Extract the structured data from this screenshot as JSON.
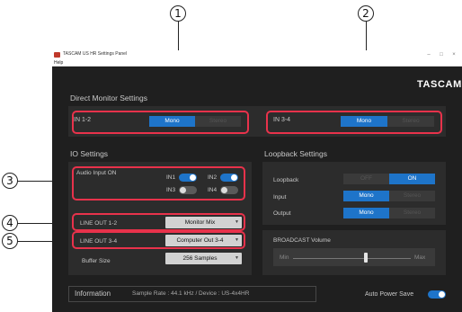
{
  "callouts": {
    "c1": "1",
    "c2": "2",
    "c3": "3",
    "c4": "4",
    "c5": "5"
  },
  "window": {
    "title": "TASCAM US HR Settings Panel",
    "menu": "Help",
    "controls": {
      "minimize": "–",
      "maximize": "□",
      "close": "×"
    },
    "logo": "TASCAM"
  },
  "direct_monitor": {
    "heading": "Direct Monitor Settings",
    "ch12": {
      "label": "IN 1-2",
      "opt_mono": "Mono",
      "opt_stereo": "Stereo",
      "selected": "Mono"
    },
    "ch34": {
      "label": "IN 3-4",
      "opt_mono": "Mono",
      "opt_stereo": "Stereo",
      "selected": "Mono"
    }
  },
  "io": {
    "heading": "IO Settings",
    "audio_input_on": {
      "label": "Audio Input ON",
      "in1": {
        "label": "IN1",
        "on": true
      },
      "in2": {
        "label": "IN2",
        "on": true
      },
      "in3": {
        "label": "IN3",
        "on": false
      },
      "in4": {
        "label": "IN4",
        "on": false
      }
    },
    "line_out_12": {
      "label": "LINE OUT 1-2",
      "value": "Monitor Mix"
    },
    "line_out_34": {
      "label": "LINE OUT 3-4",
      "value": "Computer Out 3-4"
    },
    "buffer": {
      "label": "Buffer Size",
      "value": "256 Samples"
    }
  },
  "loopback": {
    "heading": "Loopback Settings",
    "loopback": {
      "label": "Loopback",
      "off": "OFF",
      "on": "ON",
      "selected": "ON"
    },
    "input": {
      "label": "Input",
      "mono": "Mono",
      "stereo": "Stereo",
      "selected": "Mono"
    },
    "output": {
      "label": "Output",
      "mono": "Mono",
      "stereo": "Stereo",
      "selected": "Mono"
    }
  },
  "broadcast": {
    "label": "BROADCAST Volume",
    "min": "Min",
    "max": "Max",
    "level": 0.62
  },
  "info": {
    "label": "Information",
    "details": "Sample Rate : 44.1 kHz  /  Device : US-4x4HR"
  },
  "auto_power_save": {
    "label": "Auto Power Save",
    "on": true
  },
  "colors": {
    "accent": "#1e74c9",
    "highlight": "#e8324b",
    "window_bg": "#1f1f1f",
    "panel_bg": "#2c2c2c"
  }
}
